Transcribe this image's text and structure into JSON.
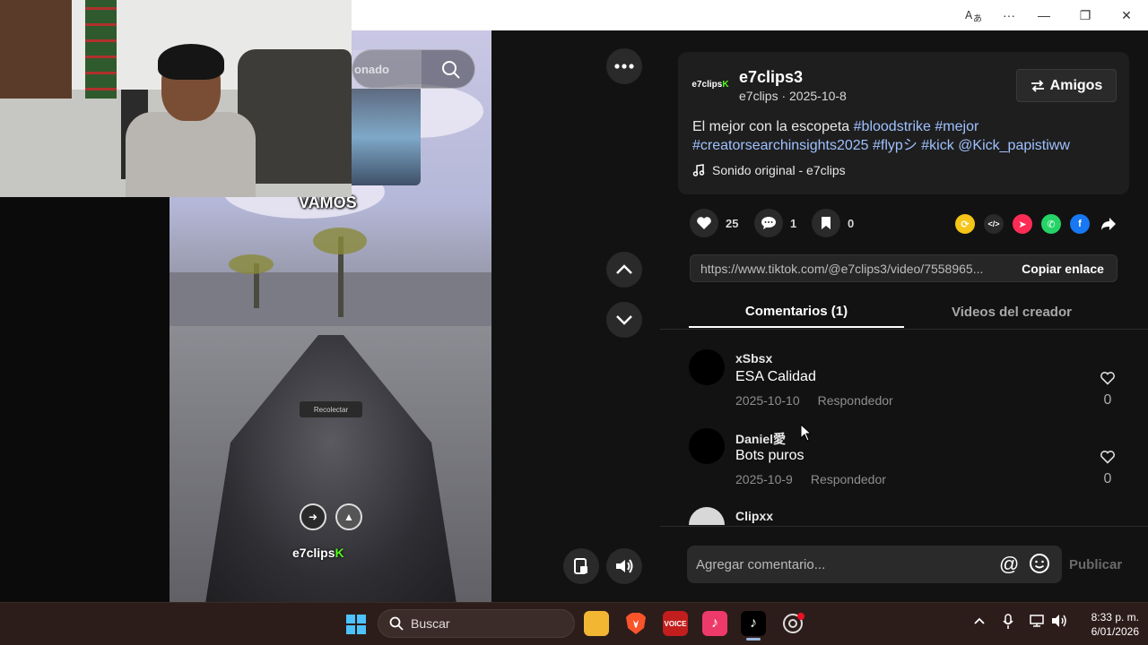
{
  "window": {
    "translate_icon": "translate-icon",
    "more_label": "···",
    "minimize_label": "—",
    "restore_label": "❐",
    "close_label": "✕"
  },
  "video": {
    "overlay_text": "VAMOS",
    "watermark_prefix": "e7clips",
    "watermark_suffix": "K",
    "search_partial_text": "onado",
    "reco_text": "Recolectar"
  },
  "creator": {
    "logo_text": "e7clips",
    "logo_k": "K",
    "name": "e7clips3",
    "subtitle": "e7clips · 2025-10-8",
    "friends_label": "Amigos",
    "description_plain": "El mejor con la escopeta ",
    "tags": [
      "#bloodstrike",
      "#mejor",
      "#creatorsearchinsights2025",
      "#flypシ",
      "#kick",
      "@Kick_papistiww"
    ],
    "sound": "Sonido original - e7clips"
  },
  "actions": {
    "likes": "25",
    "comments": "1",
    "saves": "0"
  },
  "share": {
    "link": "https://www.tiktok.com/@e7clips3/video/7558965...",
    "copy_label": "Copiar enlace"
  },
  "tabs": {
    "comments": "Comentarios (1)",
    "creator_videos": "Videos del creador"
  },
  "comments": [
    {
      "user": "xSbsx",
      "text": "ESA Calidad",
      "date": "2025-10-10",
      "reply": "Respondedor",
      "likes": "0"
    },
    {
      "user": "Daniel愛",
      "text": "Bots puros",
      "date": "2025-10-9",
      "reply": "Respondedor",
      "likes": "0"
    },
    {
      "user": "Clipxx",
      "text": "",
      "date": "",
      "reply": "",
      "likes": ""
    }
  ],
  "comment_box": {
    "placeholder": "Agregar comentario...",
    "publish_label": "Publicar"
  },
  "taskbar": {
    "search_label": "Buscar",
    "voicemod_label": "VOICE",
    "time": "8:33 p. m.",
    "date": "6/01/2026"
  },
  "colors": {
    "accent_tag": "#9ec1ff",
    "kick_green": "#53fc18",
    "panel_bg": "#121212",
    "card_bg": "#1e1e1e"
  }
}
